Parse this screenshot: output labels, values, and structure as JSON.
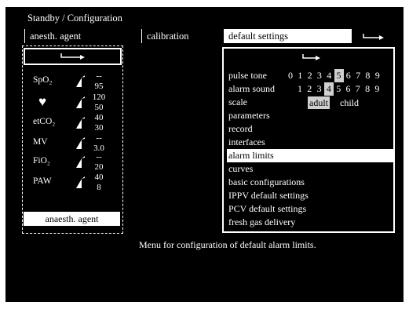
{
  "title": "Standby / Configuration",
  "tabs": {
    "anesth_agent": "anesth. agent",
    "calibration": "calibration",
    "default_settings": "default settings"
  },
  "left_panel": {
    "params": [
      {
        "label": "SpO₂",
        "upper": "--",
        "lower": "95"
      },
      {
        "label": "♥",
        "upper": "120",
        "lower": "50"
      },
      {
        "label": "etCO₂",
        "upper": "40",
        "lower": "30"
      },
      {
        "label": "MV",
        "upper": "--",
        "lower": "3.0"
      },
      {
        "label": "FiO₂",
        "upper": "--",
        "lower": "20"
      },
      {
        "label": "PAW",
        "upper": "40",
        "lower": "8"
      }
    ],
    "agent_button": "anaesth. agent"
  },
  "right_panel": {
    "pulse_tone": {
      "label": "pulse tone",
      "values": [
        "0",
        "1",
        "2",
        "3",
        "4",
        "5",
        "6",
        "7",
        "8",
        "9"
      ],
      "selected": "5"
    },
    "alarm_sound": {
      "label": "alarm sound",
      "values": [
        "1",
        "2",
        "3",
        "4",
        "5",
        "6",
        "7",
        "8",
        "9"
      ],
      "selected": "4"
    },
    "scale": {
      "label": "scale",
      "options": [
        "adult",
        "child"
      ],
      "selected": "adult"
    },
    "menu": [
      "parameters",
      "record",
      "interfaces",
      "alarm limits",
      "curves",
      "basic configurations",
      "IPPV default settings",
      "PCV default settings",
      "fresh gas delivery"
    ],
    "selected_menu": "alarm limits"
  },
  "hint": "Menu for configuration of default alarm limits."
}
